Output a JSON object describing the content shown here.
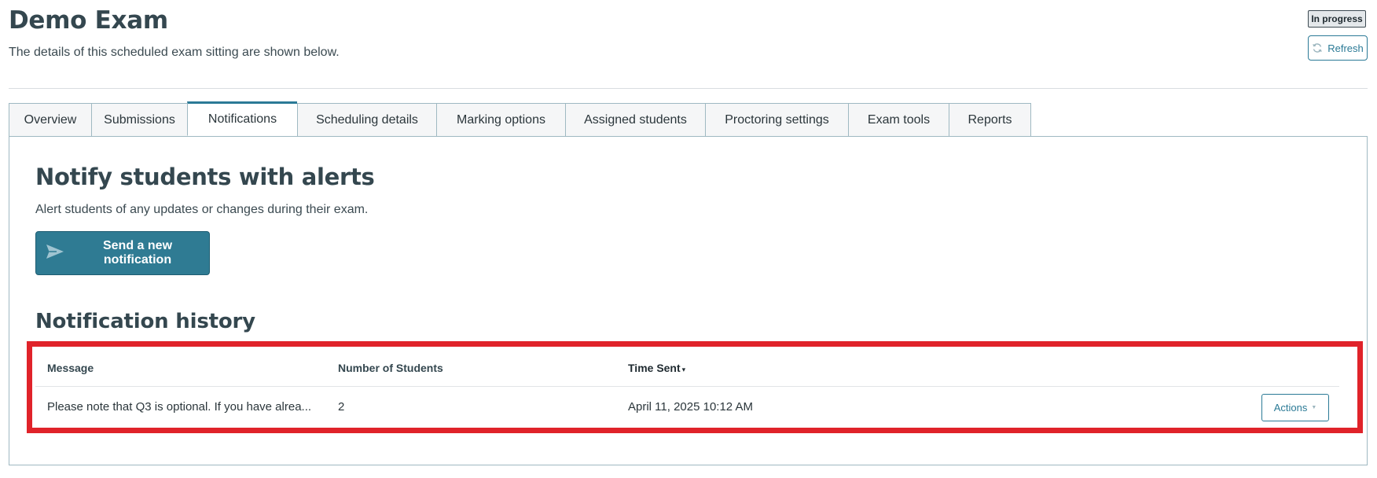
{
  "header": {
    "title": "Demo Exam",
    "subtitle": "The details of this scheduled exam sitting are shown below.",
    "status": "In progress",
    "refresh_label": "Refresh"
  },
  "tabs": [
    {
      "label": "Overview"
    },
    {
      "label": "Submissions"
    },
    {
      "label": "Notifications",
      "active": true
    },
    {
      "label": "Scheduling details"
    },
    {
      "label": "Marking options"
    },
    {
      "label": "Assigned students"
    },
    {
      "label": "Proctoring settings"
    },
    {
      "label": "Exam tools"
    },
    {
      "label": "Reports"
    }
  ],
  "notifications": {
    "title": "Notify students with alerts",
    "description": "Alert students of any updates or changes during their exam.",
    "send_button_label": "Send a new notification",
    "history_title": "Notification history",
    "columns": {
      "message": "Message",
      "students": "Number of Students",
      "time_sent": "Time Sent"
    },
    "sort_indicator": "▾",
    "rows": [
      {
        "message": "Please note that Q3 is optional. If you have alrea...",
        "students": "2",
        "time_sent": "April 11, 2025 10:12 AM",
        "actions_label": "Actions"
      }
    ]
  },
  "colors": {
    "accent": "#2b7a96",
    "primary_button": "#2f7b93",
    "highlight": "#e0232a",
    "heading": "#34474f"
  }
}
